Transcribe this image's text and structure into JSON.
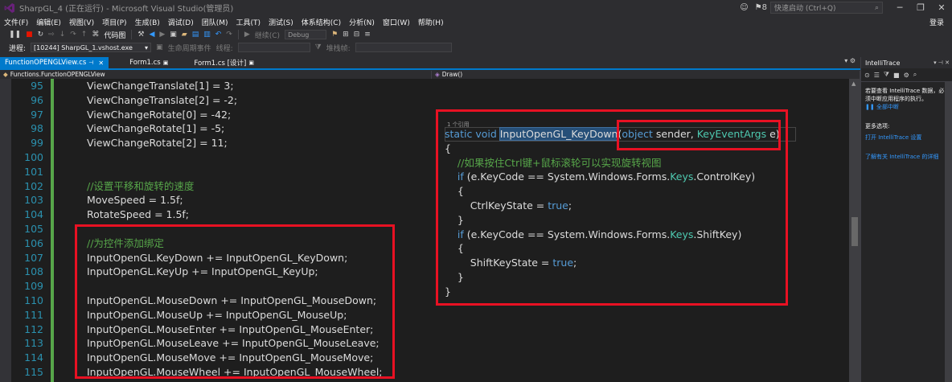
{
  "window": {
    "title": "SharpGL_4 (正在运行) - Microsoft Visual Studio(管理员)",
    "notifications": "8",
    "quick_launch_placeholder": "快速启动 (Ctrl+Q)",
    "minimize": "─",
    "restore": "❐",
    "close": "✕",
    "login": "登录"
  },
  "menu": [
    "文件(F)",
    "编辑(E)",
    "视图(V)",
    "项目(P)",
    "生成(B)",
    "调试(D)",
    "团队(M)",
    "工具(T)",
    "测试(S)",
    "体系结构(C)",
    "分析(N)",
    "窗口(W)",
    "帮助(H)"
  ],
  "toolbar": {
    "code_map": "代码图",
    "continue": "继续(C)",
    "config": "Debug",
    "process_label": "进程:",
    "process_value": "[10244] SharpGL_1.vshost.exe",
    "lifecycle": "生命周期事件",
    "thread": "线程:",
    "stack": "堆栈帧:"
  },
  "tabs": [
    {
      "label": "FunctionOPENGLView.cs",
      "active": true
    },
    {
      "label": "Form1.cs",
      "active": false
    },
    {
      "label": "Form1.cs [设计]",
      "active": false
    }
  ],
  "nav": {
    "left": "Functions.FunctionOPENGLView",
    "right": "Draw()"
  },
  "editor": {
    "line_numbers": [
      "95",
      "96",
      "97",
      "98",
      "99",
      "100",
      "101",
      "102",
      "103",
      "104",
      "105",
      "106",
      "107",
      "108",
      "109",
      "110",
      "111",
      "112",
      "113",
      "114",
      "115"
    ],
    "left_lines": [
      "ViewChangeTranslate[1] = 3;",
      "ViewChangeTranslate[2] = -2;",
      "ViewChangeRotate[0] = -42;",
      "ViewChangeRotate[1] = -5;",
      "ViewChangeRotate[2] = 11;",
      "",
      "",
      "//设置平移和旋转的速度",
      "MoveSpeed = 1.5f;",
      "RotateSpeed = 1.5f;",
      "",
      "//为控件添加绑定",
      "InputOpenGL.KeyDown += InputOpenGL_KeyDown;",
      "InputOpenGL.KeyUp += InputOpenGL_KeyUp;",
      "",
      "InputOpenGL.MouseDown += InputOpenGL_MouseDown;",
      "InputOpenGL.MouseUp += InputOpenGL_MouseUp;",
      "InputOpenGL.MouseEnter += InputOpenGL_MouseEnter;",
      "InputOpenGL.MouseLeave += InputOpenGL_MouseLeave;",
      "InputOpenGL.MouseMove += InputOpenGL_MouseMove;",
      "InputOpenGL.MouseWheel += InputOpenGL_MouseWheel;"
    ],
    "references": "1 个引用",
    "sig": {
      "static": "static",
      "void": "void",
      "method": "InputOpenGL_KeyDown",
      "open": "(",
      "object": "object",
      "sender": " sender, ",
      "eventargs": "KeyEventArgs",
      "e": " e)"
    },
    "right_lines": [
      "{",
      "    //如果按住Ctrl键+鼠标滚轮可以实现旋转视图",
      "    if (e.KeyCode == System.Windows.Forms.Keys.ControlKey)",
      "    {",
      "        CtrlKeyState = true;",
      "    }",
      "    if (e.KeyCode == System.Windows.Forms.Keys.ShiftKey)",
      "    {",
      "        ShiftKeyState = true;",
      "    }",
      "}"
    ],
    "if1": {
      "pre": "(e.KeyCode == System.Windows.Forms.",
      "keys": "Keys",
      "post": ".ControlKey)"
    },
    "if2": {
      "pre": "(e.KeyCode == System.Windows.Forms.",
      "keys": "Keys",
      "post": ".ShiftKey)"
    },
    "ctrl_assign": "CtrlKeyState = ",
    "shift_assign": "ShiftKeyState = ",
    "true_kw": "true",
    "if_kw": "if",
    "semicolon": ";"
  },
  "panel": {
    "title": "IntelliTrace",
    "desc": "若要查看 IntelliTrace 数据，必须中断应用程序的执行。",
    "break_all": "全部中断",
    "more_options": "更多选项:",
    "open_settings": "打开 IntelliTrace 设置",
    "learn_more": "了解有关 IntelliTrace 的详细"
  },
  "colors": {
    "accent": "#007acc",
    "highlight_box": "#e81123",
    "comment": "#57a64a",
    "keyword": "#569cd6",
    "type": "#4ec9b0",
    "line_number": "#2b91af"
  }
}
